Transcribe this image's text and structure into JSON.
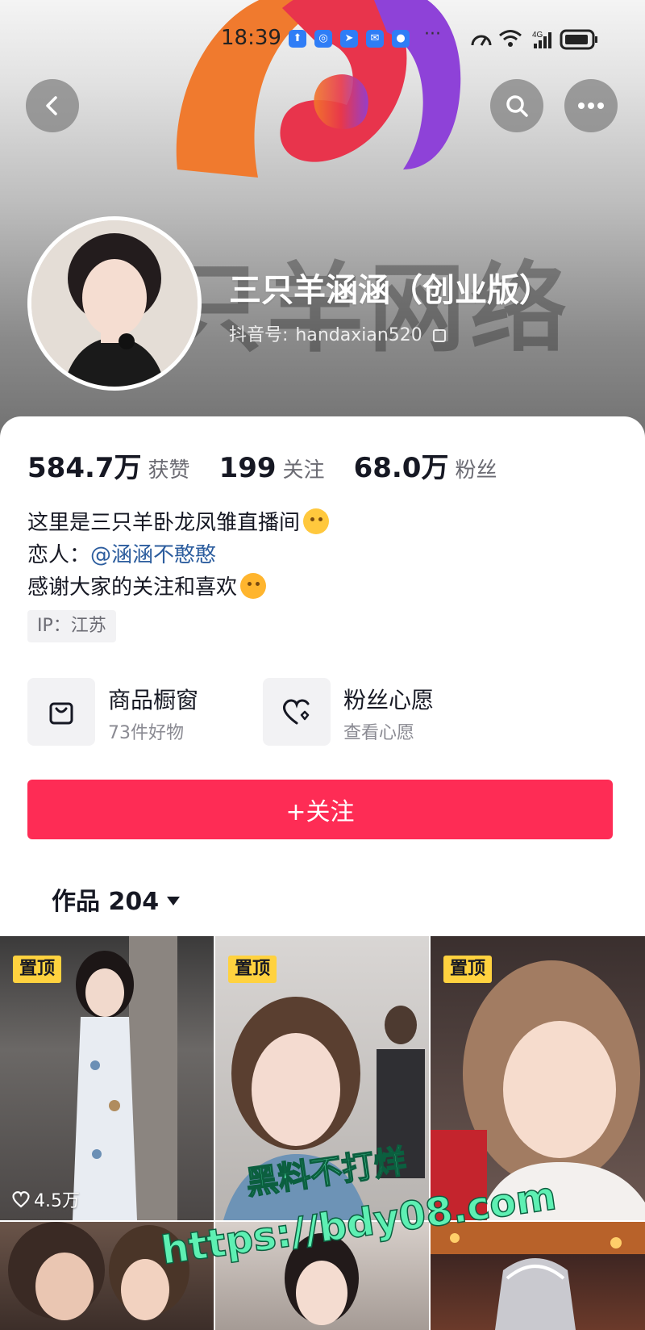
{
  "status_bar": {
    "time": "18:39",
    "more": "···",
    "network": "4G"
  },
  "nav": {
    "back_icon": "chevron-left-icon",
    "search_icon": "search-icon",
    "more_icon": "more-horizontal-icon"
  },
  "profile": {
    "nickname": "三只羊涵涵（创业版）",
    "id_label": "抖音号:",
    "id_value": "handaxian520"
  },
  "stats": [
    {
      "num": "584.7万",
      "label": "获赞"
    },
    {
      "num": "199",
      "label": "关注"
    },
    {
      "num": "68.0万",
      "label": "粉丝"
    }
  ],
  "bio": {
    "line1": "这里是三只羊卧龙凤雏直播间",
    "line2_prefix": "恋人：",
    "line2_mention": "@涵涵不憨憨",
    "line3": "感谢大家的关注和喜欢"
  },
  "ip_tag": "IP：江苏",
  "shortcuts": [
    {
      "title": "商品橱窗",
      "sub": "73件好物",
      "icon": "shopping-bag-icon"
    },
    {
      "title": "粉丝心愿",
      "sub": "查看心愿",
      "icon": "heart-wish-icon"
    }
  ],
  "follow_button": "+关注",
  "works_tab": {
    "label": "作品 204"
  },
  "grid": {
    "pin_label": "置顶",
    "items": [
      {
        "likes": "4.5万",
        "pinned": true
      },
      {
        "likes": "",
        "pinned": true
      },
      {
        "likes": "",
        "pinned": true
      },
      {
        "likes": "",
        "pinned": false
      },
      {
        "likes": "",
        "pinned": false
      },
      {
        "likes": "",
        "pinned": false
      }
    ]
  },
  "watermark": {
    "line1": "黑料不打烊",
    "line2": "https://bdy08.com"
  },
  "colors": {
    "accent": "#fe2c55",
    "pin": "#ffd23f",
    "mention": "#2c5d9e",
    "watermark": "#5ef0b3"
  }
}
